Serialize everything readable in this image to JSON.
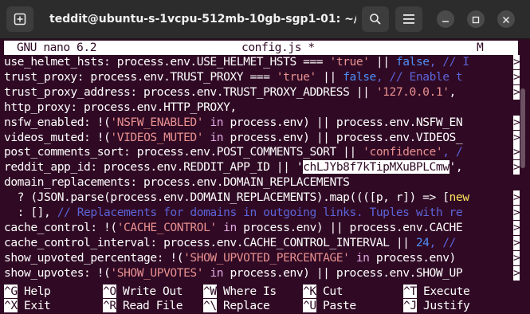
{
  "window": {
    "title": "teddit@ubuntu-s-1vcpu-512mb-10gb-sgp1-01: ~/te...",
    "icons": {
      "new_tab": "new-tab-icon",
      "search": "search-icon",
      "menu": "hamburger-menu-icon",
      "minimize": "minimize-icon",
      "maximize": "maximize-icon",
      "close": "close-icon"
    }
  },
  "nano": {
    "version": "GNU nano 6.2",
    "filename": "config.js *",
    "modified_flag": "M"
  },
  "lines": [
    [
      {
        "t": "use_helmet_hsts: process.env.USE_HELMET_HSTS === "
      },
      {
        "t": "'true'",
        "c": "s"
      },
      {
        "t": " || "
      },
      {
        "t": "false",
        "c": "n"
      },
      {
        "t": ", // ",
        "c": "c"
      },
      {
        "t": "I",
        "c": "c"
      }
    ],
    [
      {
        "t": "trust_proxy: process.env.TRUST_PROXY === "
      },
      {
        "t": "'true'",
        "c": "s"
      },
      {
        "t": " || "
      },
      {
        "t": "false",
        "c": "n"
      },
      {
        "t": ", // Enable t",
        "c": "c"
      }
    ],
    [
      {
        "t": "trust_proxy_address: process.env.TRUST_PROXY_ADDRESS || "
      },
      {
        "t": "'127.0.0.1'",
        "c": "s"
      },
      {
        "t": ", "
      }
    ],
    [
      {
        "t": "http_proxy: process.env.HTTP_PROXY,"
      }
    ],
    [
      {
        "t": "nsfw_enabled: !("
      },
      {
        "t": "'NSFW_ENABLED'",
        "c": "s"
      },
      {
        "t": " in",
        "c": "k"
      },
      {
        "t": " process.env) || process.env.NSFW_EN"
      }
    ],
    [
      {
        "t": "videos_muted: !("
      },
      {
        "t": "'VIDEOS_MUTED'",
        "c": "s"
      },
      {
        "t": " in",
        "c": "k"
      },
      {
        "t": " process.env) || process.env.VIDEOS_"
      }
    ],
    [
      {
        "t": "post_comments_sort: process.env.POST_COMMENTS_SORT || "
      },
      {
        "t": "'confidence'",
        "c": "s"
      },
      {
        "t": ", /",
        "c": "c"
      }
    ],
    [
      {
        "t": "reddit_app_id: process.env.REDDIT_APP_ID || '"
      },
      {
        "t": "chLJYb8f7kTipMXuBPLCmw",
        "c": "hl"
      },
      {
        "t": "',"
      }
    ],
    [
      {
        "t": "domain_replacements: process.env.DOMAIN_REPLACEMENTS"
      }
    ],
    [
      {
        "t": "  ? (JSON.parse(process.env.DOMAIN_REPLACEMENTS).map((([p, r]) => ["
      },
      {
        "t": "new",
        "c": "y"
      }
    ],
    [
      {
        "t": "  : [], "
      },
      {
        "t": "// Replacements for domains in outgoing links. Tuples with re",
        "c": "c"
      }
    ],
    [
      {
        "t": "cache_control: !("
      },
      {
        "t": "'CACHE_CONTROL'",
        "c": "s"
      },
      {
        "t": " in",
        "c": "k"
      },
      {
        "t": " process.env) || process.env.CACHE"
      }
    ],
    [
      {
        "t": "cache_control_interval: process.env.CACHE_CONTROL_INTERVAL || "
      },
      {
        "t": "24",
        "c": "n"
      },
      {
        "t": ", //",
        "c": "c"
      }
    ],
    [
      {
        "t": "show_upvoted_percentage: !("
      },
      {
        "t": "'SHOW_UPVOTED_PERCENTAGE'",
        "c": "s"
      },
      {
        "t": " in",
        "c": "k"
      },
      {
        "t": " process.env)"
      }
    ],
    [
      {
        "t": "show_upvotes: !("
      },
      {
        "t": "'SHOW_UPVOTES'",
        "c": "s"
      },
      {
        "t": " in",
        "c": "k"
      },
      {
        "t": " process.env) || process.env.SHOW_UP"
      }
    ]
  ],
  "truncated_rows": [
    0,
    1,
    2,
    4,
    5,
    6,
    7,
    9,
    10,
    11,
    12,
    13,
    14
  ],
  "truncation_marker": ">",
  "shortcuts": [
    {
      "key": "^G",
      "label": "Help"
    },
    {
      "key": "^O",
      "label": "Write Out"
    },
    {
      "key": "^W",
      "label": "Where Is"
    },
    {
      "key": "^K",
      "label": "Cut"
    },
    {
      "key": "^T",
      "label": "Execute"
    },
    {
      "key": "^X",
      "label": "Exit"
    },
    {
      "key": "^R",
      "label": "Read File"
    },
    {
      "key": "^\\",
      "label": "Replace"
    },
    {
      "key": "^U",
      "label": "Paste"
    },
    {
      "key": "^J",
      "label": "Justify"
    }
  ],
  "colors": {
    "background": "#300a24",
    "string": "#e99090",
    "comment": "#5c63d8",
    "keyword": "#e2a9e4",
    "number": "#4f8ef7"
  }
}
